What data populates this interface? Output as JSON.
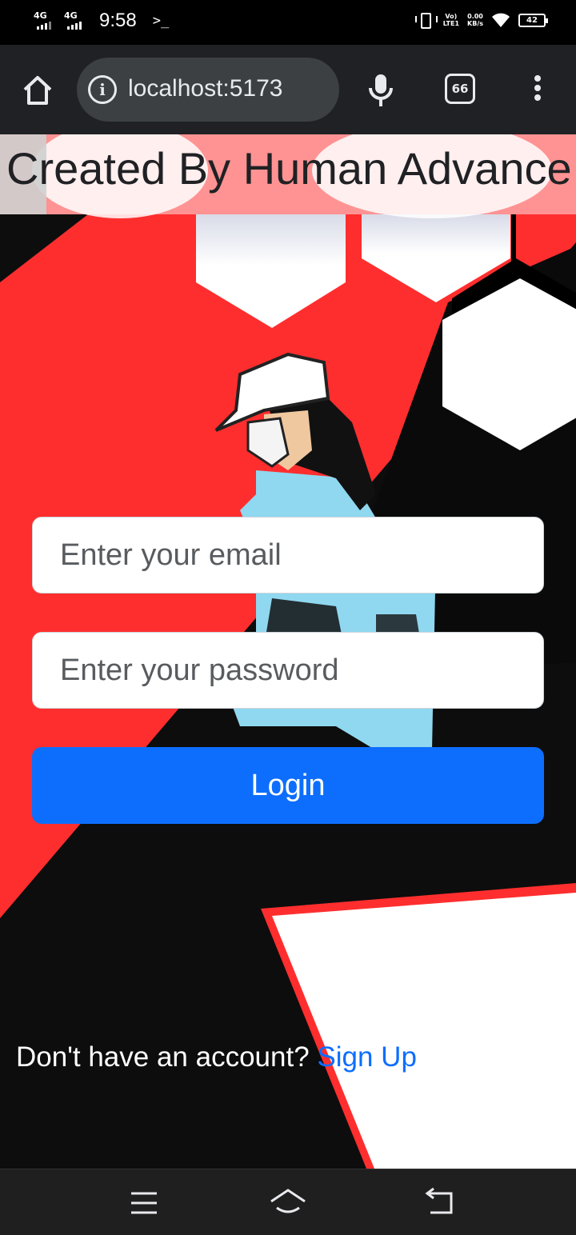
{
  "status_bar": {
    "network_1": "4G",
    "network_2": "4G",
    "time": "9:58",
    "terminal_glyph": ">_",
    "volte_line1": "Vo)",
    "volte_line2": "LTE1",
    "speed_value": "0.00",
    "speed_unit": "KB/s",
    "battery_level": "42"
  },
  "browser": {
    "url": "localhost:5173",
    "tab_count": "66"
  },
  "page": {
    "marquee_text": "Created By Human Advance T",
    "email_placeholder": "Enter your email",
    "password_placeholder": "Enter your password",
    "login_label": "Login",
    "signup_prompt": "Don't have an account? ",
    "signup_link": "Sign Up"
  },
  "colors": {
    "primary_button": "#0d6efd",
    "link": "#0d6efd",
    "accent_red": "#ff2a2a",
    "background": "#0d0d0d"
  },
  "nav_bar": {
    "icons": [
      "menu-icon",
      "home-icon",
      "back-icon"
    ]
  }
}
